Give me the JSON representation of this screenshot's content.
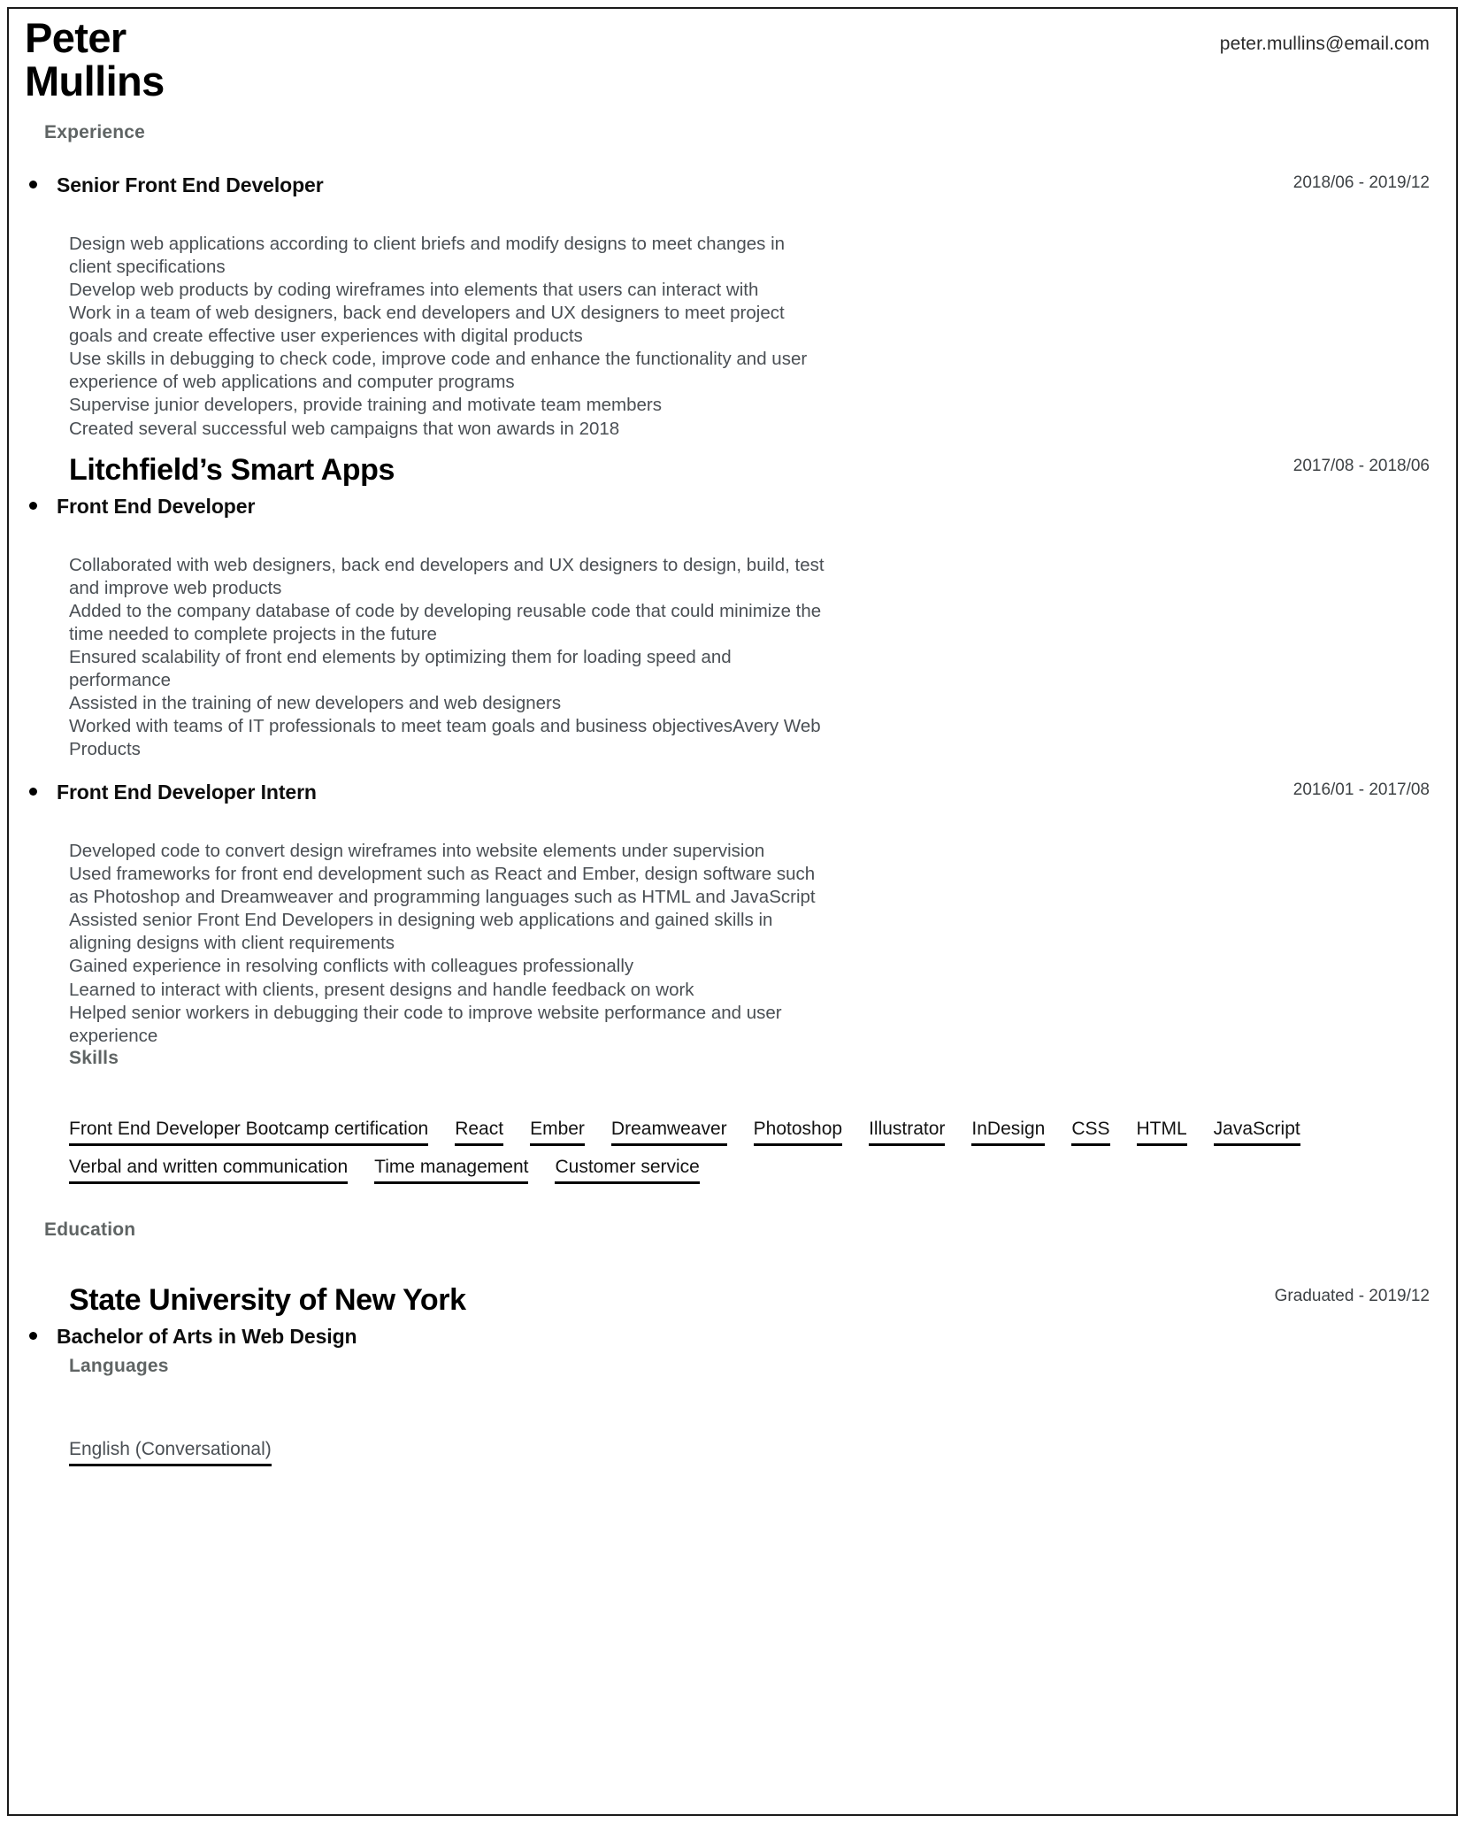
{
  "document": {
    "type": "resume",
    "full_name_line1": "Peter",
    "full_name_line2": "Mullins",
    "email": "peter.mullins@email.com"
  },
  "sections": {
    "experience_heading": "Experience",
    "skills_heading": "Skills",
    "education_heading": "Education",
    "languages_heading": "Languages"
  },
  "experience": [
    {
      "title": "Senior Front End Developer",
      "date": "2018/06 - 2019/12",
      "company": "",
      "description": "Design web applications according to client briefs and modify designs to meet changes in client specifications\nDevelop web products by coding wireframes into elements that users can interact with\nWork in a team of web designers, back end developers and UX designers to meet project goals and create effective user experiences with digital products\nUse skills in debugging to check code, improve code and enhance the functionality and user experience of web applications and computer programs\nSupervise junior developers, provide training and motivate team members\nCreated several successful web campaigns that won awards in 2018"
    },
    {
      "title": "Front End Developer",
      "date": "2017/08 - 2018/06",
      "company": "Litchfield’s Smart Apps",
      "description": "Collaborated with web designers, back end developers and UX designers to design, build, test and improve web products\nAdded to the company database of code by developing reusable code that could minimize the time needed to complete projects in the future\nEnsured scalability of front end elements by optimizing them for loading speed and performance\nAssisted in the training of new developers and web designers\nWorked with teams of IT professionals to meet team goals and business objectivesAvery Web Products"
    },
    {
      "title": "Front End Developer Intern",
      "date": "2016/01 - 2017/08",
      "company": "",
      "description": "Developed code to convert design wireframes into website elements under supervision\nUsed frameworks for front end development such as React and Ember, design software such as Photoshop and Dreamweaver and programming languages such as HTML and JavaScript\nAssisted senior Front End Developers in designing web applications and gained skills in aligning designs with client requirements\nGained experience in resolving conflicts with colleagues professionally\nLearned to interact with clients, present designs and handle feedback on work\nHelped senior workers in debugging their code to improve website performance and user experience"
    }
  ],
  "skills": [
    "Front End Developer Bootcamp certification",
    "React",
    "Ember",
    "Dreamweaver",
    "Photoshop",
    "Illustrator",
    "InDesign",
    "CSS",
    "HTML",
    "JavaScript",
    "Verbal and written communication",
    "Time management",
    "Customer service"
  ],
  "education": [
    {
      "school": "State University of New York",
      "date": "Graduated - 2019/12",
      "degree": "Bachelor of Arts in Web Design"
    }
  ],
  "languages": [
    "English  (Conversational)"
  ],
  "colors": {
    "text_primary": "#000000",
    "text_body": "#4a4f54",
    "section_heading": "#5f6464",
    "border": "#1a1a1a",
    "background": "#ffffff"
  }
}
